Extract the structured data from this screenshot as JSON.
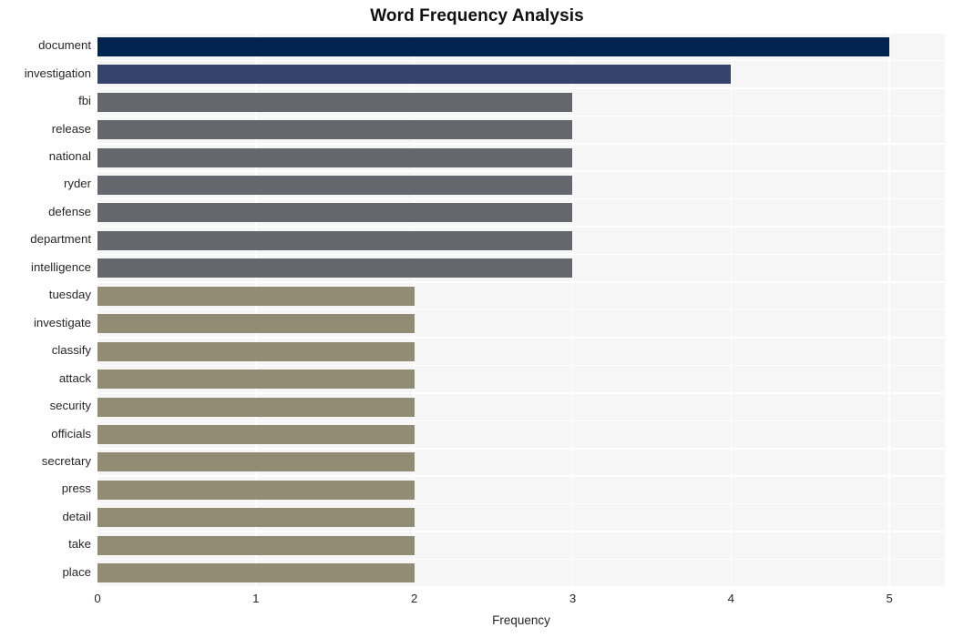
{
  "chart_data": {
    "type": "bar",
    "orientation": "horizontal",
    "title": "Word Frequency Analysis",
    "xlabel": "Frequency",
    "ylabel": "",
    "xlim": [
      0,
      5.35
    ],
    "xticks": [
      0,
      1,
      2,
      3,
      4,
      5
    ],
    "xtick_labels": [
      "0",
      "1",
      "2",
      "3",
      "4",
      "5"
    ],
    "grid": true,
    "legend": false,
    "categories": [
      "document",
      "investigation",
      "fbi",
      "release",
      "national",
      "ryder",
      "defense",
      "department",
      "intelligence",
      "tuesday",
      "investigate",
      "classify",
      "attack",
      "security",
      "officials",
      "secretary",
      "press",
      "detail",
      "take",
      "place"
    ],
    "values": [
      5,
      4,
      3,
      3,
      3,
      3,
      3,
      3,
      3,
      2,
      2,
      2,
      2,
      2,
      2,
      2,
      2,
      2,
      2,
      2
    ],
    "bar_colors": [
      "#012350",
      "#36436d",
      "#65676e",
      "#65676e",
      "#65676e",
      "#65676e",
      "#65676e",
      "#65676e",
      "#65676e",
      "#938c75",
      "#938c75",
      "#938c75",
      "#938c75",
      "#938c75",
      "#938c75",
      "#938c75",
      "#938c75",
      "#938c75",
      "#938c75",
      "#938c75"
    ]
  },
  "style": {
    "plot_background": "#f6f6f7",
    "grid_color": "#ffffff",
    "text_color": "#262626",
    "title_color": "#101010"
  }
}
